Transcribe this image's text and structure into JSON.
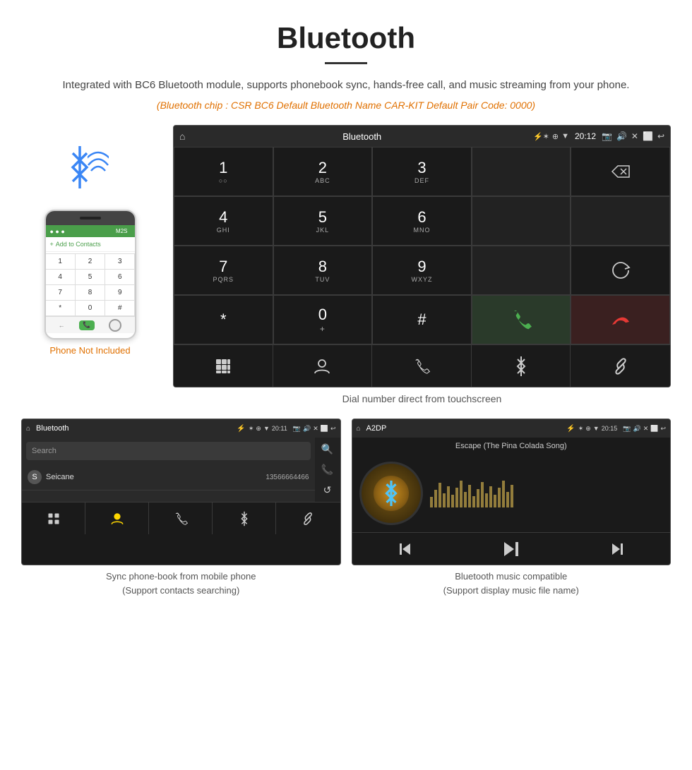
{
  "page": {
    "title": "Bluetooth",
    "subtitle": "Integrated with BC6 Bluetooth module, supports phonebook sync, hands-free call, and music streaming from your phone.",
    "orange_info": "(Bluetooth chip : CSR BC6    Default Bluetooth Name CAR-KIT    Default Pair Code: 0000)",
    "dial_caption": "Dial number direct from touchscreen"
  },
  "status_bar": {
    "title": "Bluetooth",
    "time": "20:12",
    "home_icon": "⌂",
    "usb_icon": "⚡",
    "bt_icon": "✶",
    "location_icon": "◉",
    "signal_icon": "▼",
    "camera_icon": "📷",
    "volume_icon": "🔊",
    "close_icon": "✕",
    "screen_icon": "⬜",
    "back_icon": "↩"
  },
  "dialpad": {
    "rows": [
      [
        {
          "label": "1",
          "sub": "○○"
        },
        {
          "label": "2",
          "sub": "ABC"
        },
        {
          "label": "3",
          "sub": "DEF"
        },
        {
          "label": "",
          "sub": ""
        },
        {
          "label": "⌫",
          "sub": ""
        }
      ],
      [
        {
          "label": "4",
          "sub": "GHI"
        },
        {
          "label": "5",
          "sub": "JKL"
        },
        {
          "label": "6",
          "sub": "MNO"
        },
        {
          "label": "",
          "sub": ""
        },
        {
          "label": "",
          "sub": ""
        }
      ],
      [
        {
          "label": "7",
          "sub": "PQRS"
        },
        {
          "label": "8",
          "sub": "TUV"
        },
        {
          "label": "9",
          "sub": "WXYZ"
        },
        {
          "label": "",
          "sub": ""
        },
        {
          "label": "↺",
          "sub": ""
        }
      ],
      [
        {
          "label": "*",
          "sub": ""
        },
        {
          "label": "0",
          "sub": "+"
        },
        {
          "label": "#",
          "sub": ""
        },
        {
          "label": "📞",
          "sub": "",
          "color": "green"
        },
        {
          "label": "📵",
          "sub": "",
          "color": "red"
        }
      ]
    ],
    "bottom_actions": [
      "⊞",
      "👤",
      "📞",
      "✶",
      "🔗"
    ]
  },
  "phonebook_screen": {
    "status_title": "Bluetooth",
    "status_time": "20:11",
    "search_placeholder": "Search",
    "contacts": [
      {
        "letter": "S",
        "name": "Seicane",
        "number": "13566664466"
      }
    ],
    "side_actions": [
      "🔍",
      "📞",
      "↺"
    ],
    "bottom_actions": [
      "⊞",
      "👤",
      "📞",
      "✶",
      "🔗"
    ],
    "active_tab": 1
  },
  "music_screen": {
    "status_title": "A2DP",
    "status_time": "20:15",
    "song_title": "Escape (The Pina Colada Song)",
    "eq_heights": [
      15,
      25,
      35,
      20,
      30,
      18,
      28,
      38,
      22,
      32,
      16,
      26,
      36,
      20,
      30,
      18,
      28,
      38,
      22,
      32
    ],
    "controls": [
      "⏮",
      "▶⏸",
      "⏭"
    ]
  },
  "phone_mockup": {
    "keys": [
      "1",
      "2",
      "3",
      "4",
      "5",
      "6",
      "7",
      "8",
      "9",
      "*",
      "0",
      "#"
    ],
    "not_included": "Phone Not Included"
  },
  "captions": {
    "phonebook": "Sync phone-book from mobile phone\n(Support contacts searching)",
    "music": "Bluetooth music compatible\n(Support display music file name)"
  }
}
